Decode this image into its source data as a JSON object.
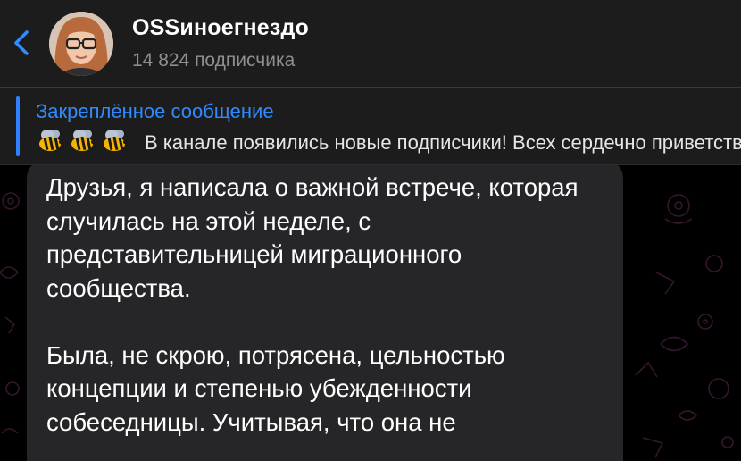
{
  "header": {
    "back_icon": "chevron-left-icon",
    "channel_name": "OSSиноегнездо",
    "subscribers": "14 824 подписчика",
    "avatar": "channel-avatar"
  },
  "pinned": {
    "title": "Закреплённое сообщение",
    "emoji": [
      "bee-emoji",
      "bee-emoji",
      "bee-emoji"
    ],
    "text": "В канале появились новые подписчики! Всех сердечно приветствую"
  },
  "message": {
    "paragraphs": [
      "Друзья, я написала о важной встрече, которая случилась на этой неделе, с представительницей миграционного сообщества.",
      "Была, не скрою, потрясена, цельностью концепции и степенью убежденности собеседницы. Учитывая, что она не"
    ]
  },
  "colors": {
    "accent": "#2f8bff",
    "header_bg": "#1c1c1d",
    "bubble_bg": "#262628",
    "secondary_text": "#8e8e93"
  }
}
